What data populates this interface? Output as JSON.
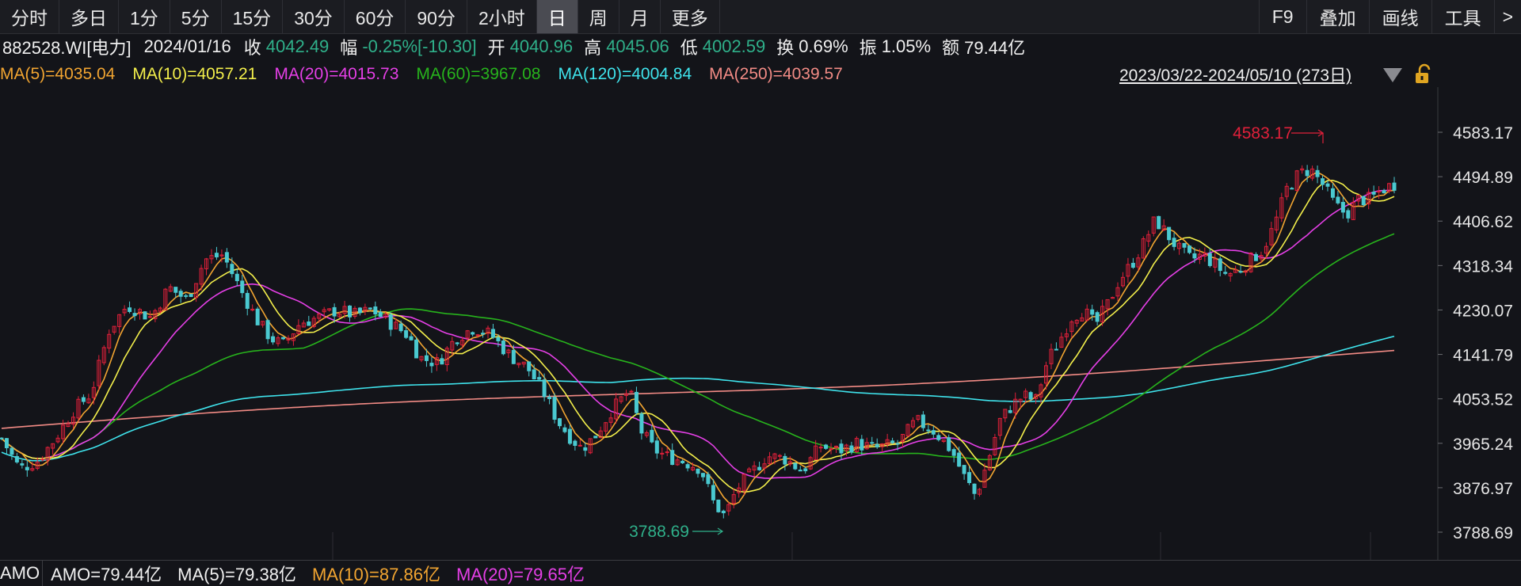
{
  "toolbar": {
    "left": [
      {
        "label": "分时",
        "active": false
      },
      {
        "label": "多日",
        "active": false
      },
      {
        "label": "1分",
        "active": false
      },
      {
        "label": "5分",
        "active": false
      },
      {
        "label": "15分",
        "active": false
      },
      {
        "label": "30分",
        "active": false
      },
      {
        "label": "60分",
        "active": false
      },
      {
        "label": "90分",
        "active": false
      },
      {
        "label": "2小时",
        "active": false
      },
      {
        "label": "日",
        "active": true
      },
      {
        "label": "周",
        "active": false
      },
      {
        "label": "月",
        "active": false
      },
      {
        "label": "更多",
        "active": false
      }
    ],
    "right": [
      "F9",
      "叠加",
      "画线",
      "工具",
      ">"
    ]
  },
  "info": {
    "symbol": "882528.WI[电力]",
    "date": "2024/01/16",
    "close_label": "收",
    "close": "4042.49",
    "change_label": "幅",
    "change": "-0.25%[-10.30]",
    "open_label": "开",
    "open": "4040.96",
    "high_label": "高",
    "high": "4045.06",
    "low_label": "低",
    "low": "4002.59",
    "turnover_label": "换",
    "turnover": "0.69%",
    "amplitude_label": "振",
    "amplitude": "1.05%",
    "amount_label": "额",
    "amount": "79.44亿"
  },
  "ma_legend": [
    {
      "text": "MA(5)=4035.04",
      "color": "#f2a531"
    },
    {
      "text": "MA(10)=4057.21",
      "color": "#f3ef4b"
    },
    {
      "text": "MA(20)=4015.73",
      "color": "#e53fe6"
    },
    {
      "text": "MA(60)=3967.08",
      "color": "#27b31c"
    },
    {
      "text": "MA(120)=4004.84",
      "color": "#3fe3ec"
    },
    {
      "text": "MA(250)=4039.57",
      "color": "#f28b85"
    }
  ],
  "range_text": "2023/03/22-2024/05/10 (273日)",
  "colors": {
    "up": "#e0203a",
    "down": "#4ac9d0",
    "ma5": "#f2a531",
    "ma10": "#f3ef4b",
    "ma20": "#e53fe6",
    "ma60": "#27b31c",
    "ma120": "#3fe3ec",
    "ma250": "#f28b85",
    "high_marker": "#e0203a",
    "low_marker": "#2fb08a",
    "axis_text": "#e6e6e6"
  },
  "chart_data": {
    "type": "candlestick",
    "y_ticks": [
      "4583.17",
      "4494.89",
      "4406.62",
      "4318.34",
      "4230.07",
      "4141.79",
      "4053.52",
      "3965.24",
      "3876.97",
      "3788.69"
    ],
    "ylim": [
      3788.69,
      4583.17
    ],
    "bars": 273,
    "high_marker": "4583.17",
    "low_marker": "3788.69",
    "close_path": [
      [
        0,
        3975
      ],
      [
        6,
        3915
      ],
      [
        12,
        3930
      ],
      [
        18,
        3975
      ],
      [
        24,
        4030
      ],
      [
        30,
        4065
      ],
      [
        36,
        4190
      ],
      [
        42,
        4240
      ],
      [
        50,
        4215
      ],
      [
        56,
        4275
      ],
      [
        62,
        4250
      ],
      [
        68,
        4330
      ],
      [
        74,
        4340
      ],
      [
        80,
        4270
      ],
      [
        86,
        4205
      ],
      [
        90,
        4175
      ],
      [
        94,
        4160
      ],
      [
        100,
        4205
      ],
      [
        106,
        4215
      ],
      [
        112,
        4230
      ],
      [
        118,
        4220
      ],
      [
        124,
        4230
      ],
      [
        130,
        4205
      ],
      [
        136,
        4180
      ],
      [
        140,
        4135
      ],
      [
        146,
        4125
      ],
      [
        152,
        4175
      ],
      [
        158,
        4195
      ],
      [
        164,
        4180
      ],
      [
        170,
        4140
      ],
      [
        176,
        4115
      ],
      [
        182,
        4060
      ],
      [
        186,
        4010
      ],
      [
        190,
        3980
      ],
      [
        194,
        3955
      ],
      [
        198,
        3975
      ],
      [
        204,
        4030
      ],
      [
        210,
        4070
      ],
      [
        214,
        3990
      ],
      [
        218,
        3955
      ],
      [
        222,
        3940
      ],
      [
        228,
        3930
      ],
      [
        234,
        3915
      ],
      [
        238,
        3850
      ],
      [
        242,
        3820
      ],
      [
        246,
        3875
      ],
      [
        250,
        3900
      ],
      [
        256,
        3940
      ],
      [
        262,
        3935
      ],
      [
        268,
        3910
      ],
      [
        274,
        3960
      ],
      [
        280,
        3950
      ],
      [
        286,
        3965
      ],
      [
        292,
        3955
      ]
    ],
    "amo_legend": {
      "name": "AMO",
      "amo": "AMO=79.44亿",
      "ma5": "MA(5)=79.38亿",
      "ma10": "MA(10)=87.86亿",
      "ma20": "MA(20)=79.65亿"
    }
  }
}
